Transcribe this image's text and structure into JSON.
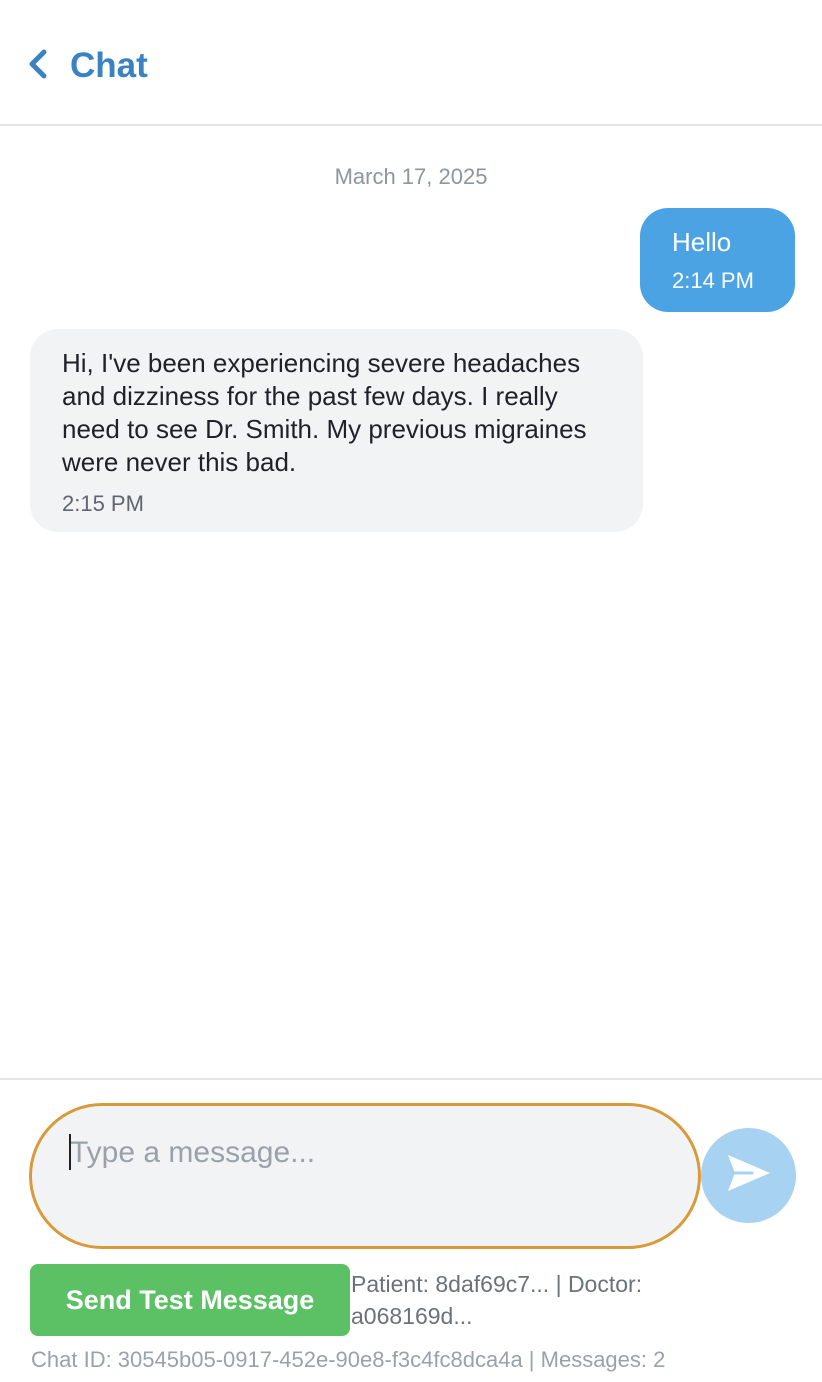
{
  "header": {
    "back_icon": "chevron-left-icon",
    "title": "Chat",
    "accent_color": "#3a82c4"
  },
  "messages": {
    "date_separator": "March 17, 2025",
    "items": [
      {
        "direction": "outgoing",
        "text": "Hello",
        "time": "2:14 PM",
        "bubble_color": "#4ba3e3"
      },
      {
        "direction": "incoming",
        "text": "Hi, I've been experiencing severe headaches and dizziness for the past few days. I really need to see Dr. Smith. My previous migraines were never this bad.",
        "time": "2:15 PM",
        "bubble_color": "#f2f3f5"
      }
    ]
  },
  "composer": {
    "value": "",
    "placeholder": "Type a message...",
    "focus_border_color": "#d89a3a",
    "send_icon": "send-icon",
    "send_button_color": "#a7d2f2"
  },
  "debug": {
    "test_button_label": "Send Test Message",
    "test_button_color": "#5cc065",
    "ids_text": "Patient: 8daf69c7... | Doctor: a068169d...",
    "footer_text": "Chat ID: 30545b05-0917-452e-90e8-f3c4fc8dca4a | Messages: 2"
  }
}
